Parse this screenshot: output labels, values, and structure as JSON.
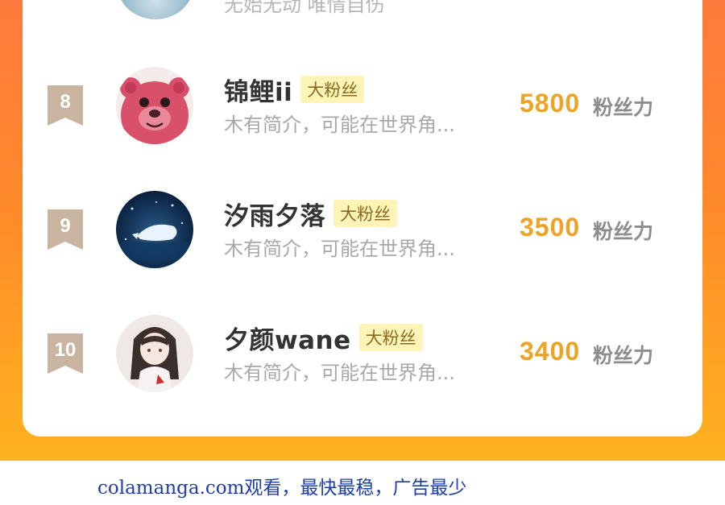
{
  "colors": {
    "background_gradient": [
      "#ff7a3c",
      "#ffb21f"
    ],
    "card": "#ffffff",
    "score": "#eca326",
    "rank_ribbon": "#c9b49f",
    "badge_bg": "#fff4b8",
    "watermark": "#1e3ea6"
  },
  "top_partial": {
    "intro": "无始无动 唯情自伤"
  },
  "ranking": [
    {
      "rank": "8",
      "name": "锦鲤ii",
      "badge": "大粉丝",
      "intro": "木有简介，可能在世界角...",
      "score": "5800",
      "unit": "粉丝力",
      "avatar": "pink-bear-avatar"
    },
    {
      "rank": "9",
      "name": "汐雨夕落",
      "badge": "大粉丝",
      "intro": "木有简介，可能在世界角...",
      "score": "3500",
      "unit": "粉丝力",
      "avatar": "night-whale-avatar"
    },
    {
      "rank": "10",
      "name": "夕颜wane",
      "badge": "大粉丝",
      "intro": "木有简介，可能在世界角...",
      "score": "3400",
      "unit": "粉丝力",
      "avatar": "anime-girl-avatar"
    }
  ],
  "watermark": "colamanga.com观看，最快最稳，广告最少"
}
